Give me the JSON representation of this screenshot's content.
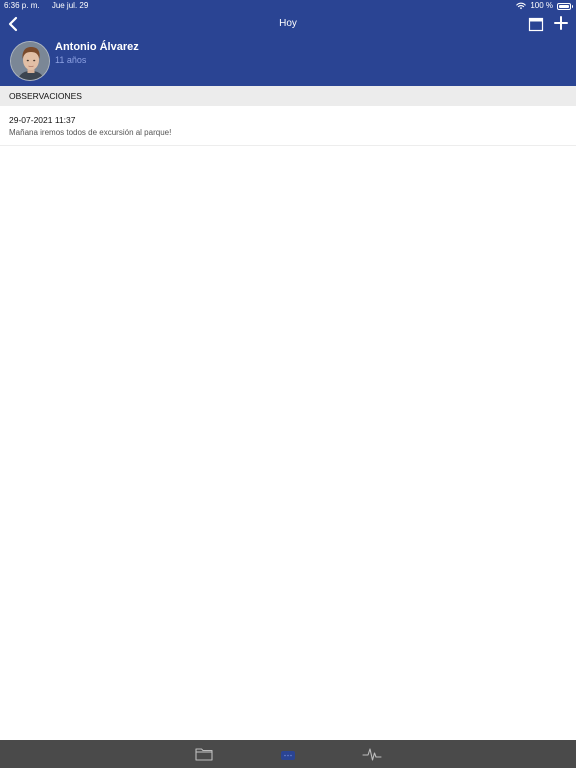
{
  "status_bar": {
    "time": "6:36 p. m.",
    "date": "Jue jul. 29",
    "battery": "100 %"
  },
  "nav": {
    "title": "Hoy",
    "back_icon": "chevron-left-icon",
    "calendar_icon": "calendar-icon",
    "add_icon": "plus-icon"
  },
  "patient": {
    "name": "Antonio Álvarez",
    "age": "11 años"
  },
  "section": {
    "title": "OBSERVACIONES"
  },
  "observations": [
    {
      "datetime": "29-07-2021 11:37",
      "text": "Mañana iremos todos de excursión al parque!"
    }
  ],
  "tabs": [
    {
      "icon": "folder-icon",
      "active": false
    },
    {
      "icon": "chat-bubble-icon",
      "active": true
    },
    {
      "icon": "heartbeat-icon",
      "active": false
    }
  ],
  "colors": {
    "header_bg": "#2a4493",
    "age_text": "#8ea2e3",
    "tab_bar_bg": "#4a4a4a",
    "tab_active": "#2a4493",
    "section_bg": "#ececec"
  }
}
